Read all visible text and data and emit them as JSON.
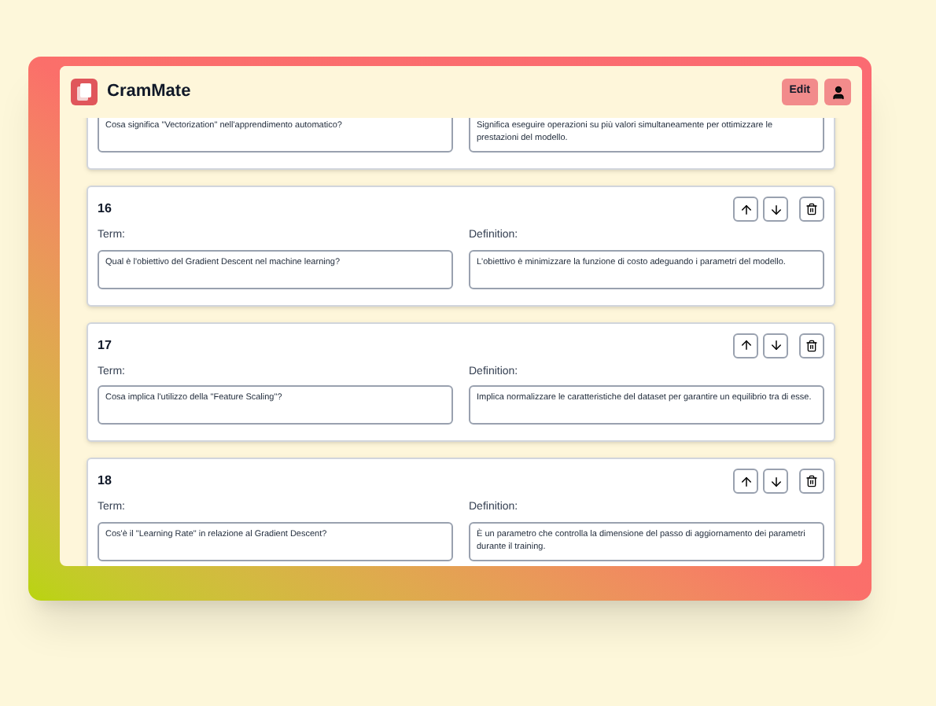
{
  "app": {
    "title": "CramMate",
    "edit_button": "Edit"
  },
  "cards": [
    {
      "term": "Cosa significa \"Vectorization\" nell'apprendimento automatico?",
      "definition": "Significa eseguire operazioni su più valori simultaneamente per ottimizzare le prestazioni del modello."
    },
    {
      "number": "16",
      "term_label": "Term:",
      "term": "Qual è l'obiettivo del Gradient Descent nel machine learning?",
      "definition_label": "Definition:",
      "definition": "L'obiettivo è minimizzare la funzione di costo adeguando i parametri del modello."
    },
    {
      "number": "17",
      "term_label": "Term:",
      "term": "Cosa implica l'utilizzo della \"Feature Scaling\"?",
      "definition_label": "Definition:",
      "definition": "Implica normalizzare le caratteristiche del dataset per garantire un equilibrio tra di esse."
    },
    {
      "number": "18",
      "term_label": "Term:",
      "term": "Cos'è il \"Learning Rate\" in relazione al Gradient Descent?",
      "definition_label": "Definition:",
      "definition": "È un parametro che controlla la dimensione del passo di aggiornamento dei parametri durante il training."
    }
  ]
}
